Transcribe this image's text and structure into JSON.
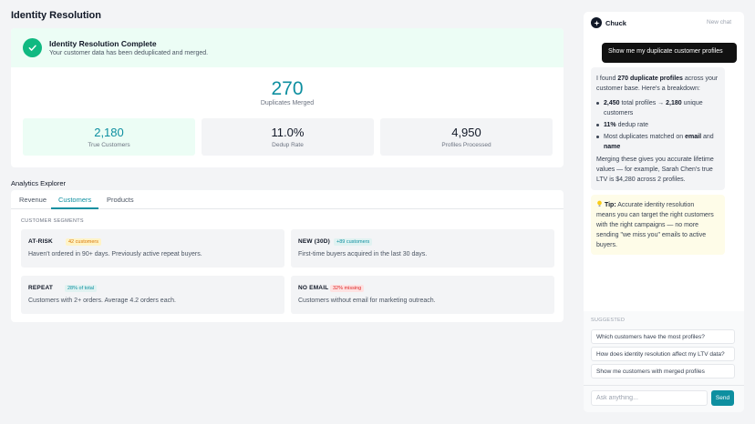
{
  "page": {
    "title": "Identity Resolution"
  },
  "summary": {
    "banner_title": "Identity Resolution Complete",
    "banner_subtitle": "Your customer data has been deduplicated and merged.",
    "duplicates_merged_value": "270",
    "duplicates_merged_label": "Duplicates Merged",
    "metrics": [
      {
        "value": "2,180",
        "label": "True Customers"
      },
      {
        "value": "11.0%",
        "label": "Dedup Rate"
      },
      {
        "value": "4,950",
        "label": "Profiles Processed"
      }
    ]
  },
  "analytics": {
    "title": "Analytics Explorer",
    "tabs": [
      {
        "label": "Revenue"
      },
      {
        "label": "Customers",
        "active": true
      },
      {
        "label": "Products"
      }
    ],
    "segments_title": "CUSTOMER SEGMENTS",
    "segments": [
      {
        "name": "AT-RISK",
        "badge": "42 customers",
        "badge_color": "#d97706",
        "badge_bg": "#fef3c7",
        "description": "Haven't ordered in 90+ days. Previously active repeat buyers."
      },
      {
        "name": "NEW (30D)",
        "badge": "+89 customers",
        "badge_color": "#0e8fa0",
        "badge_bg": "#e0f2f1",
        "description": "First-time buyers acquired in the last 30 days."
      },
      {
        "name": "REPEAT",
        "badge": "28% of total",
        "badge_color": "#0e8fa0",
        "badge_bg": "#e0f2f1",
        "description": "Customers with 2+ orders. Average 4.2 orders each."
      },
      {
        "name": "NO EMAIL",
        "badge": "32% missing",
        "badge_color": "#dc2626",
        "badge_bg": "#fee2e2",
        "description": "Customers without email for marketing outreach."
      }
    ]
  },
  "chat": {
    "name": "Chuck",
    "new_chat_label": "New chat",
    "user_message": "Show me my duplicate customer profiles",
    "bot": {
      "intro_pre": "I found ",
      "intro_bold": "270 duplicate profiles",
      "intro_post_1": " across your",
      "intro_post_2": "customer base. Here's a breakdown:",
      "bullet1_bold_a": "2,450",
      "bullet1_mid": " total profiles → ",
      "bullet1_bold_b": "2,180",
      "bullet1_post": " unique",
      "bullet1_line2": "customers",
      "bullet2_bold": "11%",
      "bullet2_post": " dedup rate",
      "bullet3_pre": "Most duplicates matched on ",
      "bullet3_bold_a": "email",
      "bullet3_mid": " and",
      "bullet3_bold_b": "name",
      "outro_1": "Merging these gives you accurate lifetime",
      "outro_2": "values — for example, Sarah Chen's true",
      "outro_3": "LTV is $4,280 across 2 profiles."
    },
    "tip": {
      "icon": "lightbulb-icon",
      "label": "Tip:",
      "line1": " Accurate identity resolution",
      "line2": "means you can target the right customers",
      "line3": "with the right campaigns — no more",
      "line4": "sending \"we miss you\" emails to active",
      "line5": "buyers."
    },
    "suggested_title": "SUGGESTED",
    "suggestions": [
      "Which customers have the most profiles?",
      "How does identity resolution affect my LTV data?",
      "Show me customers with merged profiles"
    ],
    "input_placeholder": "Ask anything...",
    "send_label": "Send"
  },
  "colors": {
    "accent": "#0e8fa0",
    "success": "#10b981",
    "success_bg": "#ecfdf5"
  }
}
